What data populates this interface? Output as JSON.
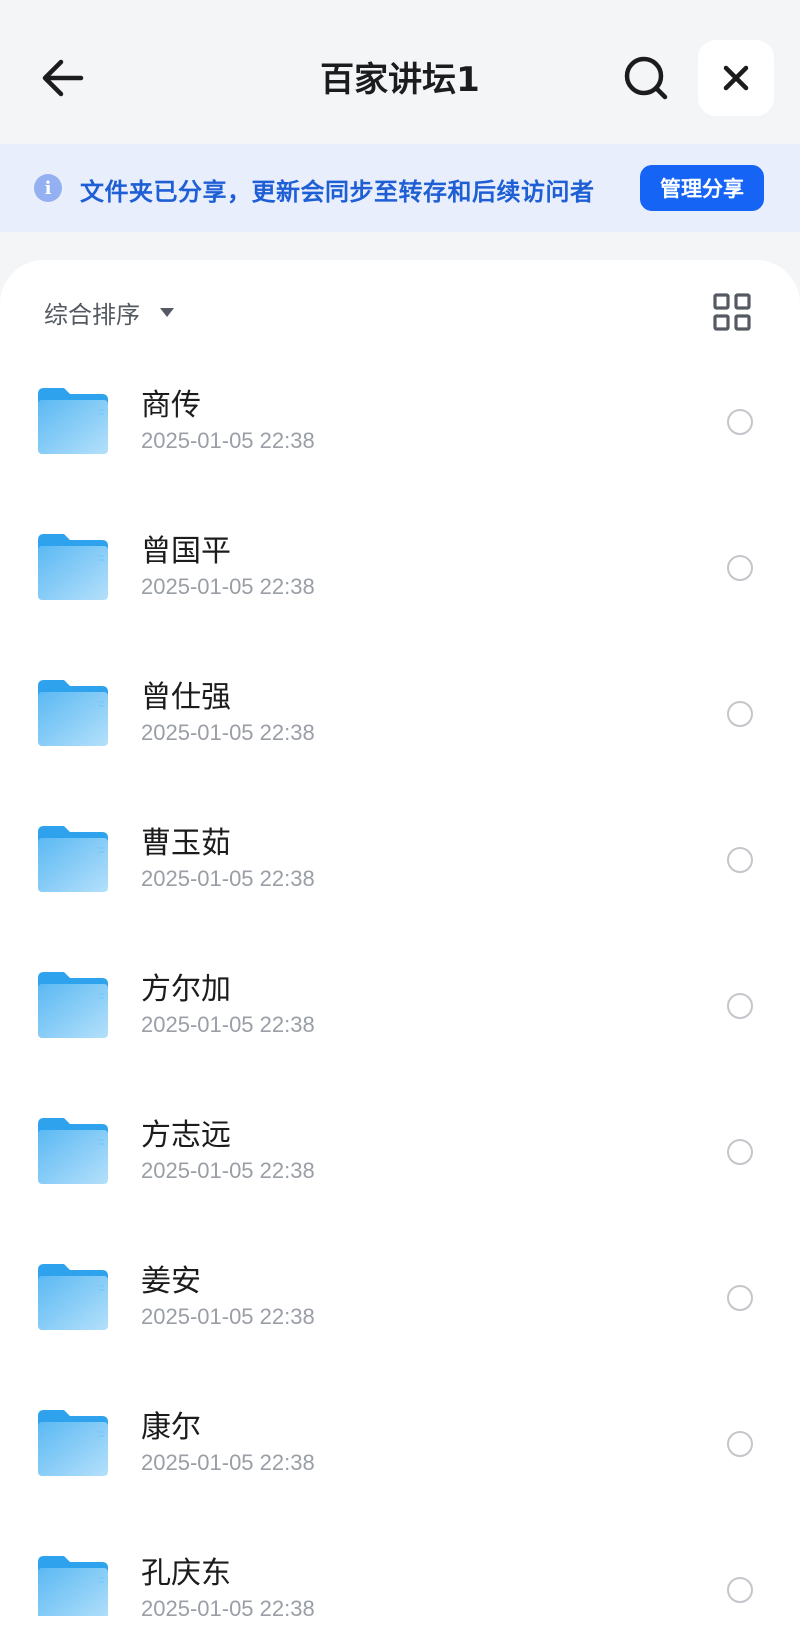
{
  "header": {
    "title": "百家讲坛1",
    "back_icon": "arrow-left-icon",
    "search_icon": "search-icon",
    "close_icon": "close-icon"
  },
  "notice": {
    "icon": "info-icon",
    "icon_glyph": "i",
    "text": "文件夹已分享，更新会同步至转存和后续访问者",
    "button_label": "管理分享",
    "accent_color": "#1664f5"
  },
  "toolbar": {
    "sort_label": "综合排序",
    "view_icon": "grid-view-icon"
  },
  "files": [
    {
      "name": "商传",
      "date": "2025-01-05 22:38"
    },
    {
      "name": "曾国平",
      "date": "2025-01-05 22:38"
    },
    {
      "name": "曾仕强",
      "date": "2025-01-05 22:38"
    },
    {
      "name": "曹玉茹",
      "date": "2025-01-05 22:38"
    },
    {
      "name": "方尔加",
      "date": "2025-01-05 22:38"
    },
    {
      "name": "方志远",
      "date": "2025-01-05 22:38"
    },
    {
      "name": "姜安",
      "date": "2025-01-05 22:38"
    },
    {
      "name": "康尔",
      "date": "2025-01-05 22:38"
    },
    {
      "name": "孔庆东",
      "date": "2025-01-05 22:38"
    }
  ],
  "colors": {
    "folder_light": "#a9daf8",
    "folder_dark": "#3aa8ee",
    "notice_bg": "#e8eefb",
    "notice_text": "#1f5fd6"
  }
}
